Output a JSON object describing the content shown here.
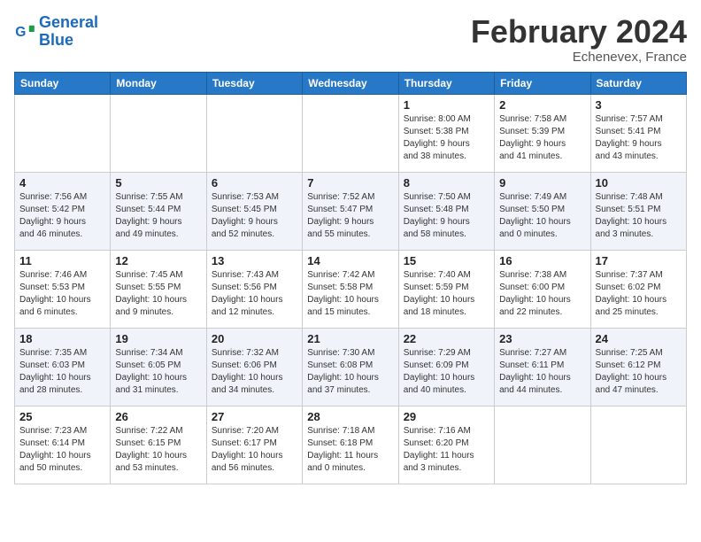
{
  "logo": {
    "text_general": "General",
    "text_blue": "Blue"
  },
  "header": {
    "title": "February 2024",
    "subtitle": "Echenevex, France"
  },
  "weekdays": [
    "Sunday",
    "Monday",
    "Tuesday",
    "Wednesday",
    "Thursday",
    "Friday",
    "Saturday"
  ],
  "weeks": [
    [
      {
        "day": "",
        "info": ""
      },
      {
        "day": "",
        "info": ""
      },
      {
        "day": "",
        "info": ""
      },
      {
        "day": "",
        "info": ""
      },
      {
        "day": "1",
        "info": "Sunrise: 8:00 AM\nSunset: 5:38 PM\nDaylight: 9 hours\nand 38 minutes."
      },
      {
        "day": "2",
        "info": "Sunrise: 7:58 AM\nSunset: 5:39 PM\nDaylight: 9 hours\nand 41 minutes."
      },
      {
        "day": "3",
        "info": "Sunrise: 7:57 AM\nSunset: 5:41 PM\nDaylight: 9 hours\nand 43 minutes."
      }
    ],
    [
      {
        "day": "4",
        "info": "Sunrise: 7:56 AM\nSunset: 5:42 PM\nDaylight: 9 hours\nand 46 minutes."
      },
      {
        "day": "5",
        "info": "Sunrise: 7:55 AM\nSunset: 5:44 PM\nDaylight: 9 hours\nand 49 minutes."
      },
      {
        "day": "6",
        "info": "Sunrise: 7:53 AM\nSunset: 5:45 PM\nDaylight: 9 hours\nand 52 minutes."
      },
      {
        "day": "7",
        "info": "Sunrise: 7:52 AM\nSunset: 5:47 PM\nDaylight: 9 hours\nand 55 minutes."
      },
      {
        "day": "8",
        "info": "Sunrise: 7:50 AM\nSunset: 5:48 PM\nDaylight: 9 hours\nand 58 minutes."
      },
      {
        "day": "9",
        "info": "Sunrise: 7:49 AM\nSunset: 5:50 PM\nDaylight: 10 hours\nand 0 minutes."
      },
      {
        "day": "10",
        "info": "Sunrise: 7:48 AM\nSunset: 5:51 PM\nDaylight: 10 hours\nand 3 minutes."
      }
    ],
    [
      {
        "day": "11",
        "info": "Sunrise: 7:46 AM\nSunset: 5:53 PM\nDaylight: 10 hours\nand 6 minutes."
      },
      {
        "day": "12",
        "info": "Sunrise: 7:45 AM\nSunset: 5:55 PM\nDaylight: 10 hours\nand 9 minutes."
      },
      {
        "day": "13",
        "info": "Sunrise: 7:43 AM\nSunset: 5:56 PM\nDaylight: 10 hours\nand 12 minutes."
      },
      {
        "day": "14",
        "info": "Sunrise: 7:42 AM\nSunset: 5:58 PM\nDaylight: 10 hours\nand 15 minutes."
      },
      {
        "day": "15",
        "info": "Sunrise: 7:40 AM\nSunset: 5:59 PM\nDaylight: 10 hours\nand 18 minutes."
      },
      {
        "day": "16",
        "info": "Sunrise: 7:38 AM\nSunset: 6:00 PM\nDaylight: 10 hours\nand 22 minutes."
      },
      {
        "day": "17",
        "info": "Sunrise: 7:37 AM\nSunset: 6:02 PM\nDaylight: 10 hours\nand 25 minutes."
      }
    ],
    [
      {
        "day": "18",
        "info": "Sunrise: 7:35 AM\nSunset: 6:03 PM\nDaylight: 10 hours\nand 28 minutes."
      },
      {
        "day": "19",
        "info": "Sunrise: 7:34 AM\nSunset: 6:05 PM\nDaylight: 10 hours\nand 31 minutes."
      },
      {
        "day": "20",
        "info": "Sunrise: 7:32 AM\nSunset: 6:06 PM\nDaylight: 10 hours\nand 34 minutes."
      },
      {
        "day": "21",
        "info": "Sunrise: 7:30 AM\nSunset: 6:08 PM\nDaylight: 10 hours\nand 37 minutes."
      },
      {
        "day": "22",
        "info": "Sunrise: 7:29 AM\nSunset: 6:09 PM\nDaylight: 10 hours\nand 40 minutes."
      },
      {
        "day": "23",
        "info": "Sunrise: 7:27 AM\nSunset: 6:11 PM\nDaylight: 10 hours\nand 44 minutes."
      },
      {
        "day": "24",
        "info": "Sunrise: 7:25 AM\nSunset: 6:12 PM\nDaylight: 10 hours\nand 47 minutes."
      }
    ],
    [
      {
        "day": "25",
        "info": "Sunrise: 7:23 AM\nSunset: 6:14 PM\nDaylight: 10 hours\nand 50 minutes."
      },
      {
        "day": "26",
        "info": "Sunrise: 7:22 AM\nSunset: 6:15 PM\nDaylight: 10 hours\nand 53 minutes."
      },
      {
        "day": "27",
        "info": "Sunrise: 7:20 AM\nSunset: 6:17 PM\nDaylight: 10 hours\nand 56 minutes."
      },
      {
        "day": "28",
        "info": "Sunrise: 7:18 AM\nSunset: 6:18 PM\nDaylight: 11 hours\nand 0 minutes."
      },
      {
        "day": "29",
        "info": "Sunrise: 7:16 AM\nSunset: 6:20 PM\nDaylight: 11 hours\nand 3 minutes."
      },
      {
        "day": "",
        "info": ""
      },
      {
        "day": "",
        "info": ""
      }
    ]
  ]
}
